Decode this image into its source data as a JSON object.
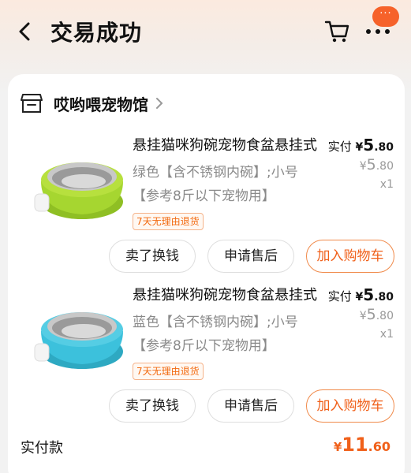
{
  "header": {
    "title": "交易成功",
    "more_badge": "···"
  },
  "shop": {
    "name": "哎哟喂宠物馆"
  },
  "items": [
    {
      "name": "悬挂猫咪狗碗宠物食盆悬挂式",
      "sku": "绿色【含不锈钢内碗】;小号【参考8斤以下宠物用】",
      "tag": "7天无理由退货",
      "paid_label": "实付",
      "currency": "¥",
      "paid_int": "5",
      "paid_dec": ".80",
      "orig_int": "5",
      "orig_dec": ".80",
      "qty": "x1",
      "bowl_color": "#a6d630",
      "buttons": {
        "sell": "卖了换钱",
        "after_sale": "申请售后",
        "add_cart": "加入购物车"
      }
    },
    {
      "name": "悬挂猫咪狗碗宠物食盆悬挂式",
      "sku": "蓝色【含不锈钢内碗】;小号【参考8斤以下宠物用】",
      "tag": "7天无理由退货",
      "paid_label": "实付",
      "currency": "¥",
      "paid_int": "5",
      "paid_dec": ".80",
      "orig_int": "5",
      "orig_dec": ".80",
      "qty": "x1",
      "bowl_color": "#3cc1dc",
      "buttons": {
        "sell": "卖了换钱",
        "after_sale": "申请售后",
        "add_cart": "加入购物车"
      }
    }
  ],
  "total": {
    "label": "实付款",
    "currency": "¥",
    "int": "11",
    "dec": ".60"
  },
  "colors": {
    "accent": "#f0601a",
    "badge": "#f6622a"
  }
}
